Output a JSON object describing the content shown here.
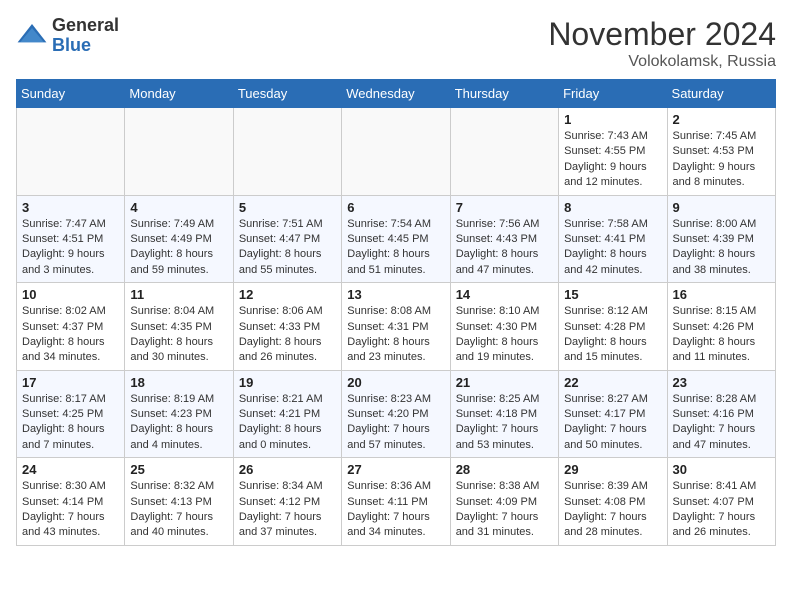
{
  "logo": {
    "general": "General",
    "blue": "Blue"
  },
  "header": {
    "month": "November 2024",
    "location": "Volokolamsk, Russia"
  },
  "days_of_week": [
    "Sunday",
    "Monday",
    "Tuesday",
    "Wednesday",
    "Thursday",
    "Friday",
    "Saturday"
  ],
  "weeks": [
    [
      {
        "day": "",
        "info": ""
      },
      {
        "day": "",
        "info": ""
      },
      {
        "day": "",
        "info": ""
      },
      {
        "day": "",
        "info": ""
      },
      {
        "day": "",
        "info": ""
      },
      {
        "day": "1",
        "sunrise": "Sunrise: 7:43 AM",
        "sunset": "Sunset: 4:55 PM",
        "daylight": "Daylight: 9 hours and 12 minutes."
      },
      {
        "day": "2",
        "sunrise": "Sunrise: 7:45 AM",
        "sunset": "Sunset: 4:53 PM",
        "daylight": "Daylight: 9 hours and 8 minutes."
      }
    ],
    [
      {
        "day": "3",
        "sunrise": "Sunrise: 7:47 AM",
        "sunset": "Sunset: 4:51 PM",
        "daylight": "Daylight: 9 hours and 3 minutes."
      },
      {
        "day": "4",
        "sunrise": "Sunrise: 7:49 AM",
        "sunset": "Sunset: 4:49 PM",
        "daylight": "Daylight: 8 hours and 59 minutes."
      },
      {
        "day": "5",
        "sunrise": "Sunrise: 7:51 AM",
        "sunset": "Sunset: 4:47 PM",
        "daylight": "Daylight: 8 hours and 55 minutes."
      },
      {
        "day": "6",
        "sunrise": "Sunrise: 7:54 AM",
        "sunset": "Sunset: 4:45 PM",
        "daylight": "Daylight: 8 hours and 51 minutes."
      },
      {
        "day": "7",
        "sunrise": "Sunrise: 7:56 AM",
        "sunset": "Sunset: 4:43 PM",
        "daylight": "Daylight: 8 hours and 47 minutes."
      },
      {
        "day": "8",
        "sunrise": "Sunrise: 7:58 AM",
        "sunset": "Sunset: 4:41 PM",
        "daylight": "Daylight: 8 hours and 42 minutes."
      },
      {
        "day": "9",
        "sunrise": "Sunrise: 8:00 AM",
        "sunset": "Sunset: 4:39 PM",
        "daylight": "Daylight: 8 hours and 38 minutes."
      }
    ],
    [
      {
        "day": "10",
        "sunrise": "Sunrise: 8:02 AM",
        "sunset": "Sunset: 4:37 PM",
        "daylight": "Daylight: 8 hours and 34 minutes."
      },
      {
        "day": "11",
        "sunrise": "Sunrise: 8:04 AM",
        "sunset": "Sunset: 4:35 PM",
        "daylight": "Daylight: 8 hours and 30 minutes."
      },
      {
        "day": "12",
        "sunrise": "Sunrise: 8:06 AM",
        "sunset": "Sunset: 4:33 PM",
        "daylight": "Daylight: 8 hours and 26 minutes."
      },
      {
        "day": "13",
        "sunrise": "Sunrise: 8:08 AM",
        "sunset": "Sunset: 4:31 PM",
        "daylight": "Daylight: 8 hours and 23 minutes."
      },
      {
        "day": "14",
        "sunrise": "Sunrise: 8:10 AM",
        "sunset": "Sunset: 4:30 PM",
        "daylight": "Daylight: 8 hours and 19 minutes."
      },
      {
        "day": "15",
        "sunrise": "Sunrise: 8:12 AM",
        "sunset": "Sunset: 4:28 PM",
        "daylight": "Daylight: 8 hours and 15 minutes."
      },
      {
        "day": "16",
        "sunrise": "Sunrise: 8:15 AM",
        "sunset": "Sunset: 4:26 PM",
        "daylight": "Daylight: 8 hours and 11 minutes."
      }
    ],
    [
      {
        "day": "17",
        "sunrise": "Sunrise: 8:17 AM",
        "sunset": "Sunset: 4:25 PM",
        "daylight": "Daylight: 8 hours and 7 minutes."
      },
      {
        "day": "18",
        "sunrise": "Sunrise: 8:19 AM",
        "sunset": "Sunset: 4:23 PM",
        "daylight": "Daylight: 8 hours and 4 minutes."
      },
      {
        "day": "19",
        "sunrise": "Sunrise: 8:21 AM",
        "sunset": "Sunset: 4:21 PM",
        "daylight": "Daylight: 8 hours and 0 minutes."
      },
      {
        "day": "20",
        "sunrise": "Sunrise: 8:23 AM",
        "sunset": "Sunset: 4:20 PM",
        "daylight": "Daylight: 7 hours and 57 minutes."
      },
      {
        "day": "21",
        "sunrise": "Sunrise: 8:25 AM",
        "sunset": "Sunset: 4:18 PM",
        "daylight": "Daylight: 7 hours and 53 minutes."
      },
      {
        "day": "22",
        "sunrise": "Sunrise: 8:27 AM",
        "sunset": "Sunset: 4:17 PM",
        "daylight": "Daylight: 7 hours and 50 minutes."
      },
      {
        "day": "23",
        "sunrise": "Sunrise: 8:28 AM",
        "sunset": "Sunset: 4:16 PM",
        "daylight": "Daylight: 7 hours and 47 minutes."
      }
    ],
    [
      {
        "day": "24",
        "sunrise": "Sunrise: 8:30 AM",
        "sunset": "Sunset: 4:14 PM",
        "daylight": "Daylight: 7 hours and 43 minutes."
      },
      {
        "day": "25",
        "sunrise": "Sunrise: 8:32 AM",
        "sunset": "Sunset: 4:13 PM",
        "daylight": "Daylight: 7 hours and 40 minutes."
      },
      {
        "day": "26",
        "sunrise": "Sunrise: 8:34 AM",
        "sunset": "Sunset: 4:12 PM",
        "daylight": "Daylight: 7 hours and 37 minutes."
      },
      {
        "day": "27",
        "sunrise": "Sunrise: 8:36 AM",
        "sunset": "Sunset: 4:11 PM",
        "daylight": "Daylight: 7 hours and 34 minutes."
      },
      {
        "day": "28",
        "sunrise": "Sunrise: 8:38 AM",
        "sunset": "Sunset: 4:09 PM",
        "daylight": "Daylight: 7 hours and 31 minutes."
      },
      {
        "day": "29",
        "sunrise": "Sunrise: 8:39 AM",
        "sunset": "Sunset: 4:08 PM",
        "daylight": "Daylight: 7 hours and 28 minutes."
      },
      {
        "day": "30",
        "sunrise": "Sunrise: 8:41 AM",
        "sunset": "Sunset: 4:07 PM",
        "daylight": "Daylight: 7 hours and 26 minutes."
      }
    ]
  ]
}
